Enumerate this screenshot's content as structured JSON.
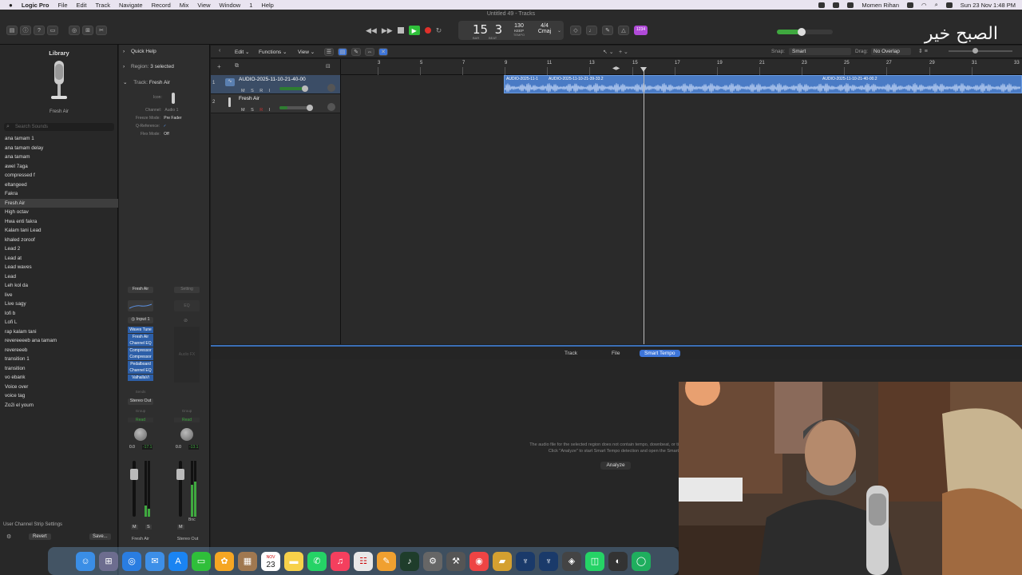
{
  "menubar": {
    "apple": "",
    "app_name": "Logic Pro",
    "items": [
      "File",
      "Edit",
      "Track",
      "Navigate",
      "Record",
      "Mix",
      "View",
      "Window",
      "1",
      "Help"
    ],
    "user": "Momen Rihan",
    "datetime": "Sun 23 Nov  1:48 PM"
  },
  "window": {
    "title": "Untitled 49 - Tracks"
  },
  "transport": {
    "position_bar": "15",
    "position_beat": "3",
    "label_bar": "BAR",
    "label_beat": "BEAT",
    "tempo": "130",
    "tempo_mode": "KEEP",
    "tempo_label": "TEMPO",
    "signature": "4/4",
    "key": "Cmaj",
    "count_badge": "1234"
  },
  "watermark": "الصبح خير",
  "library": {
    "title": "Library",
    "preset_name": "Fresh Air",
    "search_placeholder": "Search Sounds",
    "items": [
      "ana tamam 1",
      "ana tamam delay",
      "ana tamam",
      "awel 7aga",
      "compressed f",
      "eltangeed",
      "Fakra",
      "Fresh Air",
      "High octav",
      "Hwa enti fakra",
      "Kalam tani Lead",
      "khaled zoroof",
      "Lead 2",
      "Lead at",
      "Lead waves",
      "Lead",
      "Leh kol da",
      "live",
      "Live sagy",
      "lofi b",
      "Lofi L",
      "rap kalam tani",
      "revereeeeb ana tamam",
      "revereeeb",
      "transition 1",
      "transition",
      "vo ebank",
      "Voice over",
      "voice tag",
      "Zo2i el youm"
    ],
    "selected_index": 7,
    "footer_settings": "User Channel Strip Settings",
    "revert_label": "Revert",
    "save_label": "Save..."
  },
  "inspector": {
    "quick_help": "Quick Help",
    "region_label": "Region:",
    "region_value": "3 selected",
    "track_label": "Track:",
    "track_value": "Fresh Air",
    "icon_label": "Icon:",
    "channel_label": "Channel:",
    "channel_value": "Audio 1",
    "freeze_label": "Freeze Mode:",
    "freeze_value": "Pre Fader",
    "qref_label": "Q-Reference:",
    "qref_value": "✓",
    "flex_label": "Flex Mode:",
    "flex_value": "Off",
    "strip1": {
      "setting": "Fresh Air",
      "input": "Input 1",
      "plugins": [
        "Waves Tune",
        "Fresh Air",
        "Channel EQ",
        "Compressor",
        "Compressor",
        "Pedalboard",
        "Channel EQ",
        "ValhallaVi"
      ],
      "sends": "Sends",
      "output": "Stereo Out",
      "group": "Group",
      "automation": "Read",
      "vol": "0.0",
      "peak": "-17.1",
      "m": "M",
      "s": "S",
      "name": "Fresh Air"
    },
    "strip2": {
      "setting": "Setting",
      "eq": "EQ",
      "audio_fx": "Audio FX",
      "group": "Group",
      "automation": "Read",
      "vol": "0.0",
      "peak": "-13.1",
      "bnc": "Bnc",
      "m": "M",
      "name": "Stereo Out"
    }
  },
  "tracks_toolbar": {
    "edit": "Edit",
    "functions": "Functions",
    "view": "View",
    "snap_label": "Snap:",
    "snap_value": "Smart",
    "drag_label": "Drag:",
    "drag_value": "No Overlap"
  },
  "ruler": {
    "bars": [
      "3",
      "5",
      "7",
      "9",
      "11",
      "13",
      "15",
      "17",
      "19",
      "21",
      "23",
      "25",
      "27",
      "29",
      "31",
      "33"
    ]
  },
  "tracks": [
    {
      "number": "1",
      "name": "AUDIO-2025-11-10-21-40-00",
      "m": "M",
      "s": "S",
      "r": "R",
      "i": "I"
    },
    {
      "number": "2",
      "name": "Fresh Air",
      "m": "M",
      "s": "S",
      "r": "R",
      "i": "I"
    }
  ],
  "regions": [
    "AUDIO-2025-11-1",
    "AUDIO-2025-11-10-21-39-33.2",
    "AUDIO-2025-11-10-21-40-00.2"
  ],
  "editor": {
    "tabs": [
      "Track",
      "File",
      "Smart Tempo"
    ],
    "active_tab": "Smart Tempo",
    "message_line1": "The audio file for the selected region does not contain tempo, downbeat, or ti",
    "message_line2": "Click \"Analyze\" to start Smart Tempo detection and open the Smart",
    "analyze_label": "Analyze"
  },
  "dock": {
    "calendar_month": "NOV",
    "calendar_day": "23"
  },
  "colors": {
    "region_blue": "#4a7bc5",
    "plugin_blue": "#2d5fa8",
    "play_green": "#2fbf3a",
    "record_red": "#e0302a",
    "tab_active": "#3d75d9"
  }
}
